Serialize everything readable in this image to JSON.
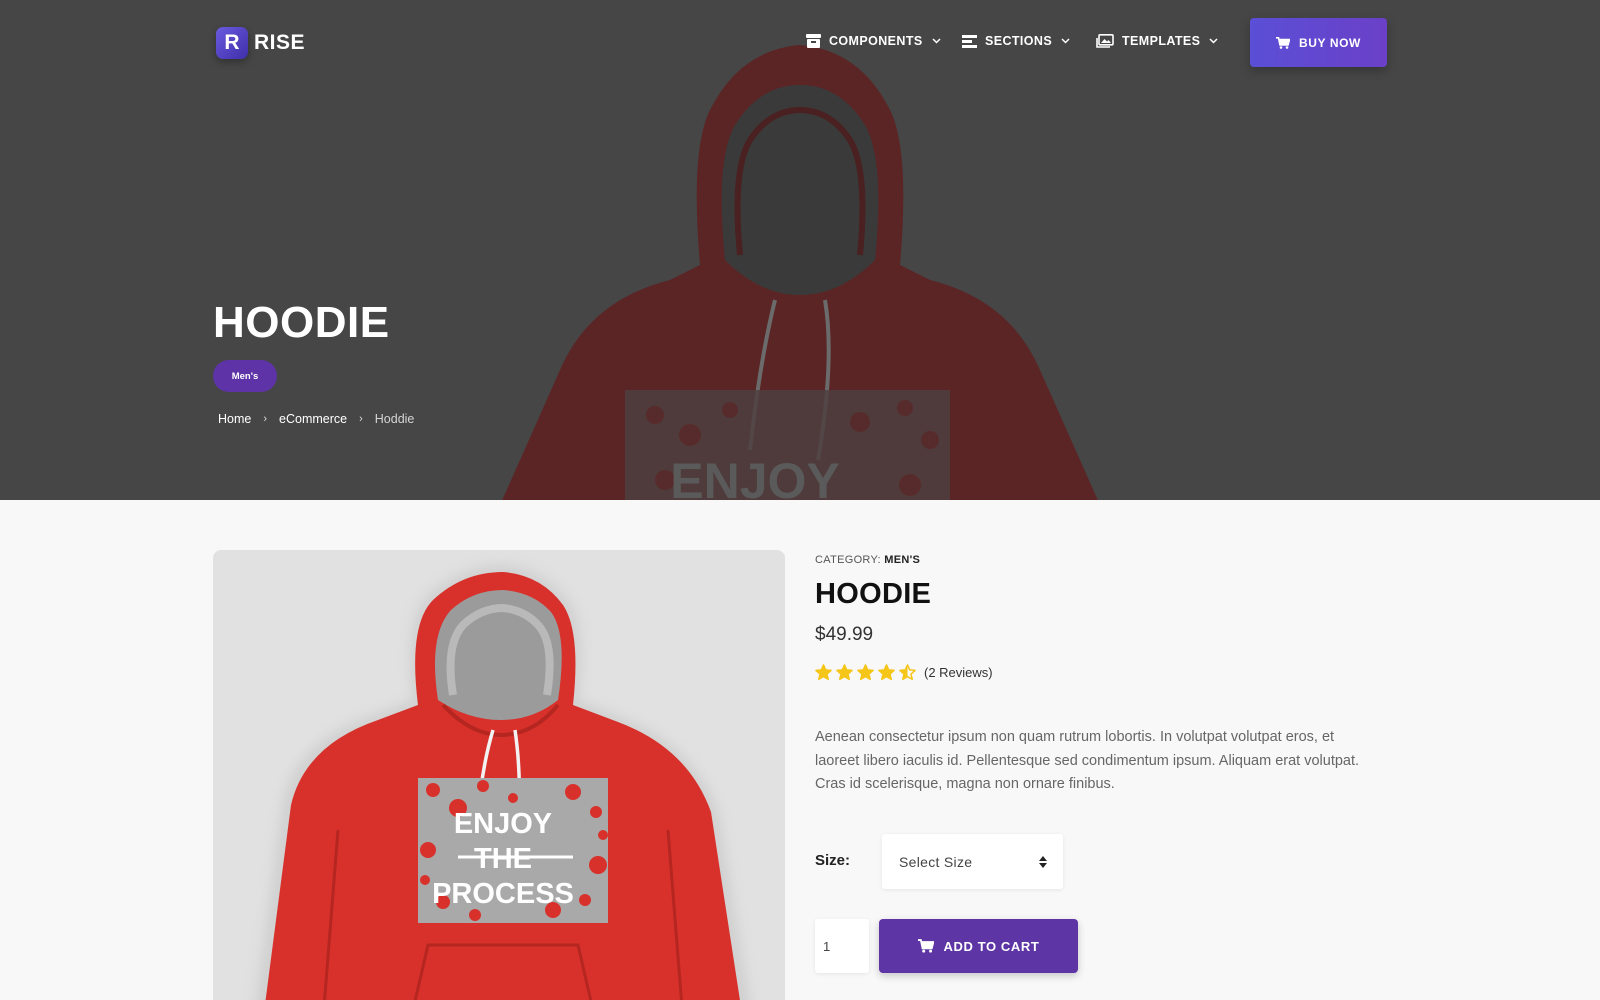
{
  "nav": {
    "logo_letter": "R",
    "logo_text": "RISE",
    "items": [
      {
        "label": "COMPONENTS",
        "icon": "archive-box-icon"
      },
      {
        "label": "SECTIONS",
        "icon": "list-lines-icon"
      },
      {
        "label": "TEMPLATES",
        "icon": "images-icon"
      }
    ],
    "buy_label": "BUY NOW"
  },
  "hero": {
    "title": "HOODIE",
    "badge": "Men's",
    "breadcrumb": [
      "Home",
      "eCommerce",
      "Hoddie"
    ],
    "graphic_text": "ENJOY"
  },
  "product": {
    "category_label": "CATEGORY:",
    "category_value": "MEN'S",
    "title": "HOODIE",
    "price": "$49.99",
    "rating": 4.5,
    "rating_max": 5,
    "reviews": "(2 Reviews)",
    "description": "Aenean consectetur ipsum non quam rutrum lobortis. In volutpat volutpat eros, et laoreet libero iaculis id. Pellentesque sed condimentum ipsum. Aliquam erat volutpat. Cras id scelerisque, magna non ornare finibus.",
    "size_label": "Size:",
    "size_placeholder": "Select Size",
    "quantity": "1",
    "add_to_cart": "ADD TO CART",
    "graphic_lines": [
      "ENJOY",
      "THE",
      "PROCESS"
    ]
  },
  "colors": {
    "accent": "#5d35a4",
    "hero_bg": "#464646",
    "star": "#f5c518",
    "hoodie_red": "#d8312b"
  }
}
